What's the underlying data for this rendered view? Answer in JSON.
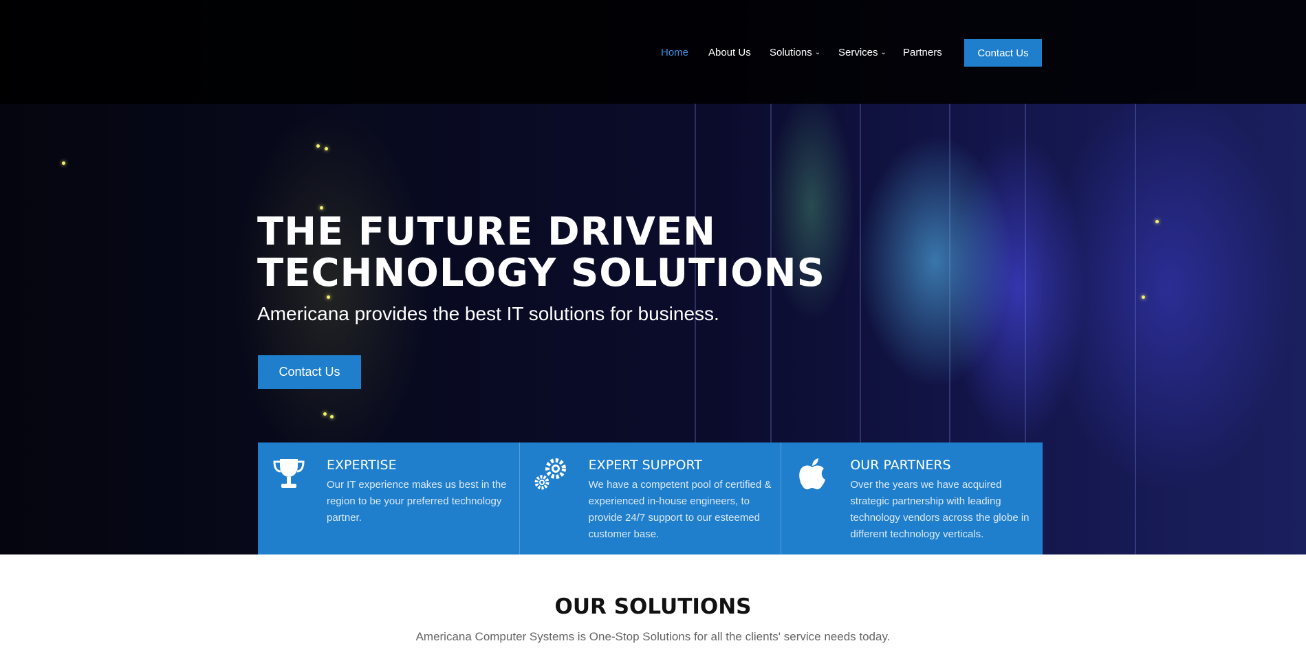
{
  "nav": {
    "items": [
      {
        "label": "Home",
        "active": true,
        "has_dropdown": false
      },
      {
        "label": "About Us",
        "active": false,
        "has_dropdown": false
      },
      {
        "label": "Solutions",
        "active": false,
        "has_dropdown": true
      },
      {
        "label": "Services",
        "active": false,
        "has_dropdown": true
      },
      {
        "label": "Partners",
        "active": false,
        "has_dropdown": false
      }
    ],
    "cta_label": "Contact Us"
  },
  "hero": {
    "title_line1": "THE FUTURE DRIVEN",
    "title_line2": "TECHNOLOGY SOLUTIONS",
    "subtitle": "Americana provides the best IT solutions for business.",
    "cta_label": "Contact Us"
  },
  "features": [
    {
      "icon": "trophy-icon",
      "title": "EXPERTISE",
      "text": "Our IT experience makes us best in the region to be your preferred technology partner."
    },
    {
      "icon": "gears-icon",
      "title": "EXPERT SUPPORT",
      "text": "We have a competent pool of certified & experienced in-house engineers, to provide 24/7 support to our esteemed customer base."
    },
    {
      "icon": "apple-icon",
      "title": "OUR PARTNERS",
      "text": "Over the years we have acquired strategic partnership with leading technology vendors across the globe in different technology verticals."
    }
  ],
  "solutions": {
    "title": "OUR SOLUTIONS",
    "subtitle": "Americana Computer Systems is One-Stop Solutions for all the clients' service needs today."
  },
  "colors": {
    "accent": "#1f7fcc",
    "active_nav": "#3c8ee0",
    "topbar": "#000000"
  }
}
